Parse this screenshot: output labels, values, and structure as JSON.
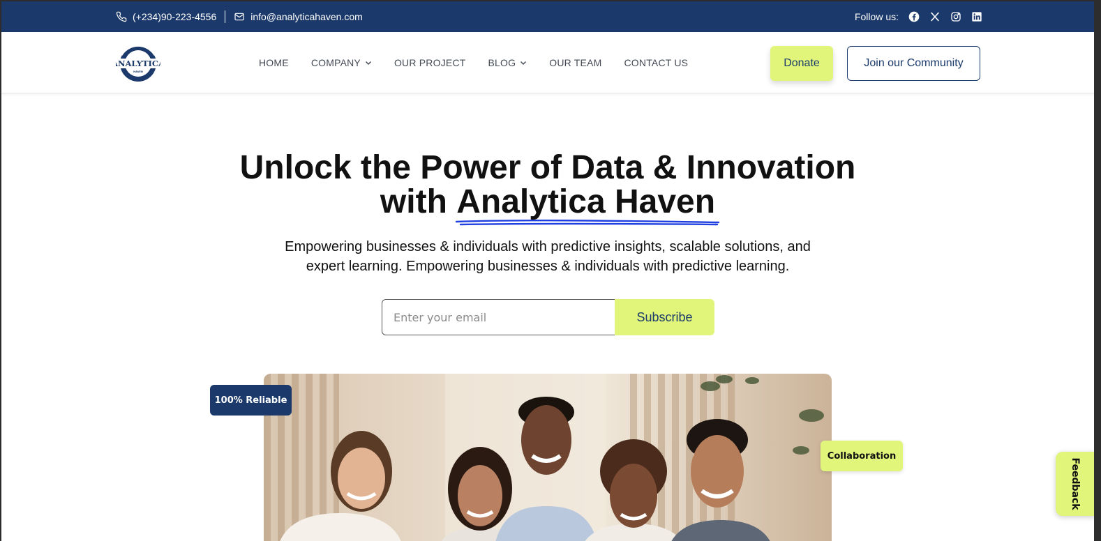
{
  "topbar": {
    "phone": "(+234)90-223-4556",
    "email": "info@analyticahaven.com",
    "follow_label": "Follow us:",
    "socials": [
      "facebook-icon",
      "x-icon",
      "instagram-icon",
      "linkedin-icon"
    ]
  },
  "brand": {
    "logo_text": "ANALYTICA",
    "logo_subtext": "HAVEN",
    "primary_color": "#1b3a6b",
    "accent_color": "#e0f57a"
  },
  "nav": {
    "items": [
      {
        "label": "HOME",
        "dropdown": false
      },
      {
        "label": "COMPANY",
        "dropdown": true
      },
      {
        "label": "OUR PROJECT",
        "dropdown": false
      },
      {
        "label": "BLOG",
        "dropdown": true
      },
      {
        "label": "OUR TEAM",
        "dropdown": false
      },
      {
        "label": "CONTACT US",
        "dropdown": false
      }
    ],
    "donate_label": "Donate",
    "join_label": "Join our Community"
  },
  "hero": {
    "title_line1": "Unlock the Power of Data & Innovation",
    "title_line2_prefix": "with ",
    "title_highlight": "Analytica Haven",
    "subtitle_line1": "Empowering businesses & individuals with predictive insights, scalable solutions, and",
    "subtitle_line2": "expert learning. Empowering businesses & individuals with predictive learning.",
    "email_placeholder": "Enter your email",
    "subscribe_label": "Subscribe"
  },
  "badges": {
    "reliable": "100% Reliable",
    "collaboration": "Collaboration"
  },
  "feedback_label": "Feedback"
}
